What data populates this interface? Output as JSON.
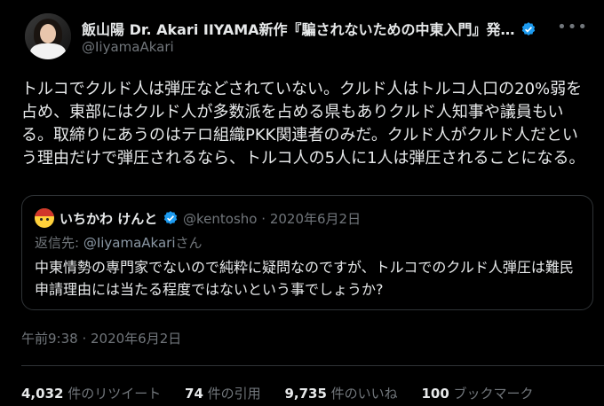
{
  "author": {
    "name": "飯山陽 Dr. Akari IIYAMA新作『騙されないための中東入門』発…",
    "handle": "@IiyamaAkari"
  },
  "tweet": {
    "text": "トルコでクルド人は弾圧などされていない。クルド人はトルコ人口の20%弱を占め、東部にはクルド人が多数派を占める県もありクルド人知事や議員もいる。取締りにあうのはテロ組織PKK関連者のみだ。クルド人がクルド人だという理由だけで弾圧されるなら、トルコ人の5人に1人は弾圧されることになる。",
    "timestamp": "午前9:38 · 2020年6月2日"
  },
  "quote": {
    "name": "いちかわ けんと",
    "handle": "@kentosho",
    "separator": "·",
    "date": "2020年6月2日",
    "reply_prefix": "返信先: ",
    "reply_mention": "@IiyamaAkari",
    "reply_suffix": "さん",
    "text": "中東情勢の専門家でないので純粋に疑問なのですが、トルコでのクルド人弾圧は難民申請理由には当たる程度ではないという事でしょうか?"
  },
  "stats": {
    "retweets": {
      "num": "4,032",
      "label": " 件のリツイート"
    },
    "quotes": {
      "num": "74",
      "label": " 件の引用"
    },
    "likes": {
      "num": "9,735",
      "label": " 件のいいね"
    },
    "bookmarks": {
      "num": "100",
      "label": " ブックマーク"
    }
  },
  "icons": {
    "more": "more-icon",
    "verified": "verified-badge-icon"
  },
  "colors": {
    "background": "#000000",
    "text": "#e7e9ea",
    "muted": "#71767b",
    "verified": "#1d9bf0",
    "border": "#2f3336"
  }
}
